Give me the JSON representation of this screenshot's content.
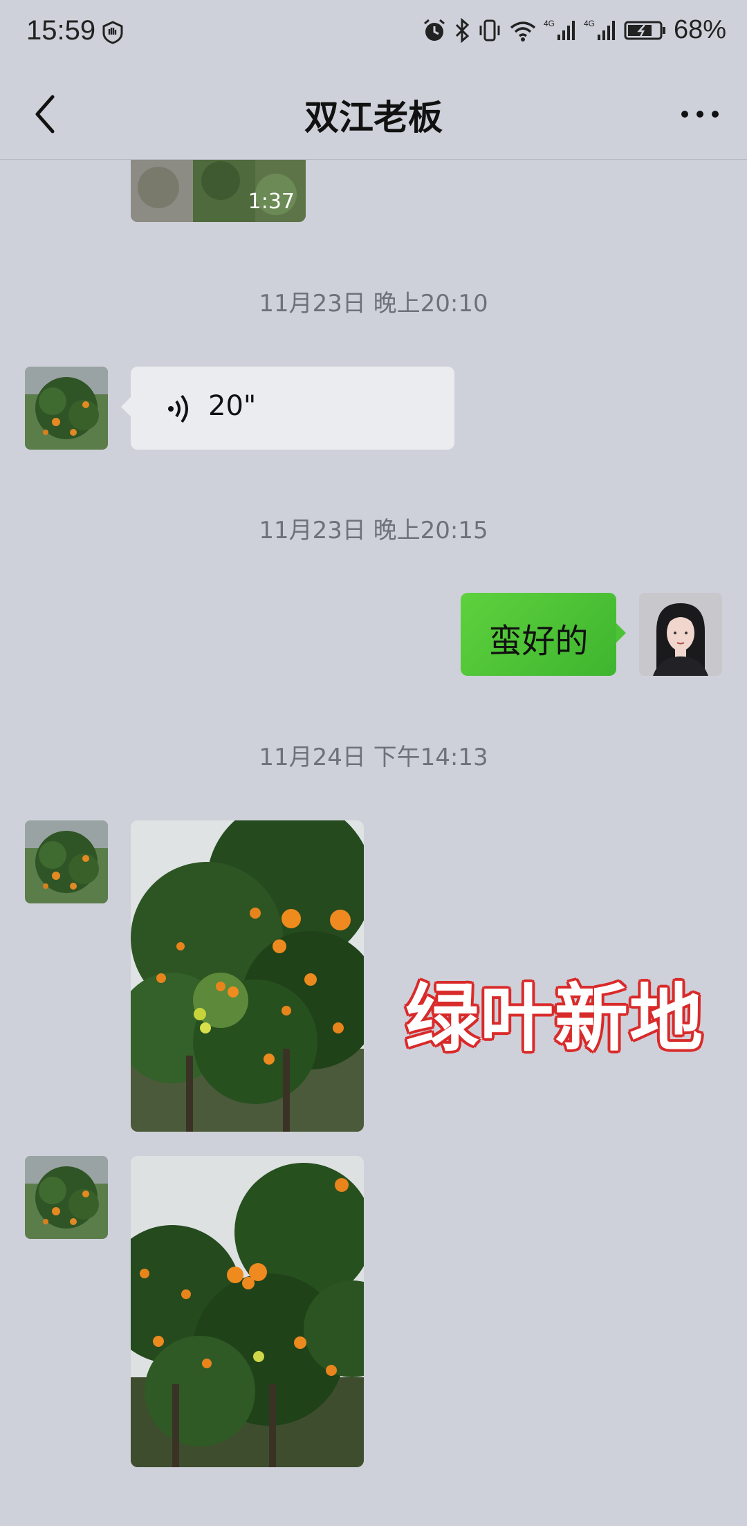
{
  "status": {
    "time": "15:59",
    "battery": "68%",
    "network": "4G"
  },
  "header": {
    "title": "双江老板"
  },
  "messages": {
    "video": {
      "duration": "1:37"
    },
    "ts1": "11月23日 晚上20:10",
    "voice": {
      "duration": "20\""
    },
    "ts2": "11月23日 晚上20:15",
    "my_text": "蛮好的",
    "ts3": "11月24日 下午14:13"
  },
  "watermark": "绿叶新地",
  "colors": {
    "background": "#cfd1da",
    "my_bubble": "#4cc336",
    "other_bubble": "#ebecef",
    "timestamp": "#6f717a",
    "watermark_outline": "#d92a2a"
  }
}
